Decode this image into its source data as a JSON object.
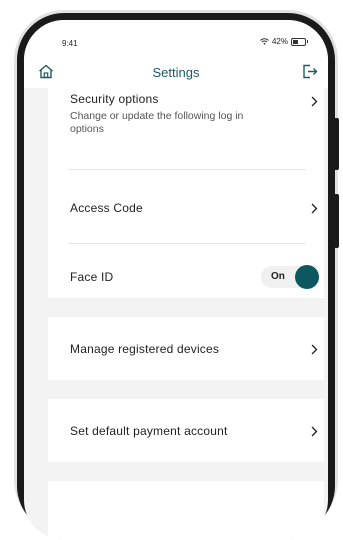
{
  "status": {
    "time": "9:41",
    "battery": "42%"
  },
  "header": {
    "title": "Settings",
    "home_icon": "home-icon",
    "logout_icon": "logout-icon"
  },
  "security": {
    "title": "Security options",
    "subtitle": "Change or update the following log in options"
  },
  "access_code": {
    "label": "Access Code"
  },
  "face_id": {
    "label": "Face ID",
    "toggle_label": "On",
    "enabled": true
  },
  "devices": {
    "label": "Manage registered devices"
  },
  "payment": {
    "label": "Set default payment account"
  },
  "colors": {
    "accent": "#0d5761",
    "title": "#1c5a63",
    "background": "#f3f3f3"
  }
}
